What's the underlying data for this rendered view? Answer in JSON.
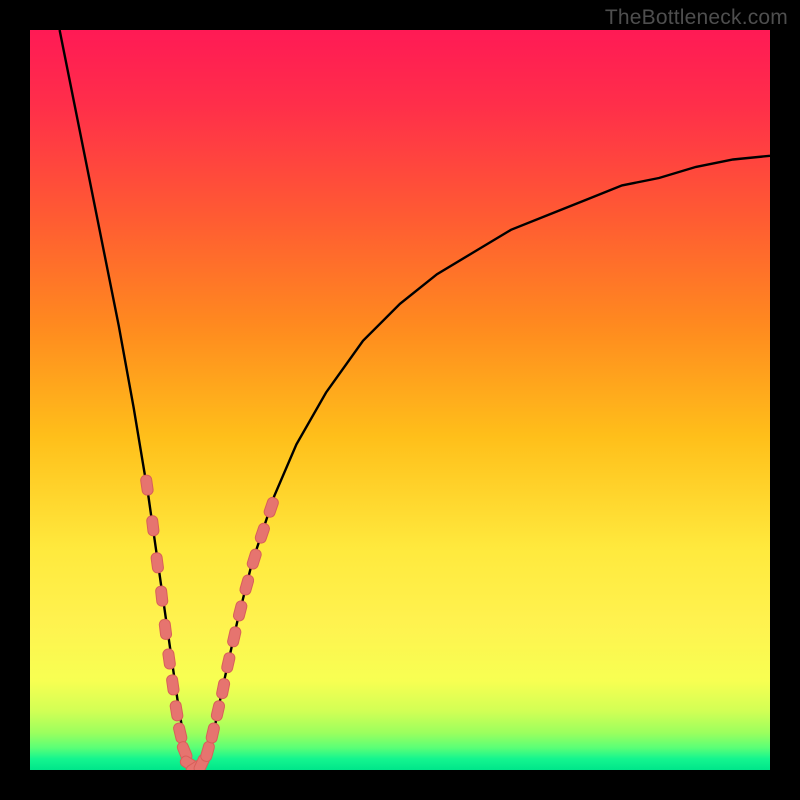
{
  "watermark": "TheBottleneck.com",
  "colors": {
    "frame": "#000000",
    "curve": "#000000",
    "marker_fill": "#e6746f",
    "marker_stroke": "#d85f5a",
    "gradient_stops": [
      {
        "offset": 0.0,
        "color": "#ff1a55"
      },
      {
        "offset": 0.1,
        "color": "#ff2e4a"
      },
      {
        "offset": 0.25,
        "color": "#ff5a33"
      },
      {
        "offset": 0.4,
        "color": "#ff8a1f"
      },
      {
        "offset": 0.55,
        "color": "#ffbf1a"
      },
      {
        "offset": 0.7,
        "color": "#ffe93d"
      },
      {
        "offset": 0.8,
        "color": "#fff24f"
      },
      {
        "offset": 0.88,
        "color": "#f7ff52"
      },
      {
        "offset": 0.92,
        "color": "#d2ff55"
      },
      {
        "offset": 0.95,
        "color": "#9bff5e"
      },
      {
        "offset": 0.97,
        "color": "#5aff77"
      },
      {
        "offset": 0.985,
        "color": "#14f58f"
      },
      {
        "offset": 1.0,
        "color": "#00e68a"
      }
    ]
  },
  "chart_data": {
    "type": "line",
    "title": "",
    "xlabel": "",
    "ylabel": "",
    "xlim": [
      0,
      100
    ],
    "ylim": [
      0,
      100
    ],
    "note": "Curve is a V-shaped dip reaching ~0 near x≈22; left branch is steep, right branch rises slowly toward ~83 at x=100. Values are estimated from the image.",
    "series": [
      {
        "name": "curve",
        "x": [
          4,
          6,
          8,
          10,
          12,
          14,
          16,
          18,
          19,
          20,
          21,
          22,
          23,
          24,
          25,
          26,
          28,
          30,
          33,
          36,
          40,
          45,
          50,
          55,
          60,
          65,
          70,
          75,
          80,
          85,
          90,
          95,
          100
        ],
        "y": [
          100,
          90,
          80,
          70,
          60,
          49,
          37,
          23,
          16,
          9,
          3,
          0,
          0,
          2,
          6,
          11,
          20,
          28,
          37,
          44,
          51,
          58,
          63,
          67,
          70,
          73,
          75,
          77,
          79,
          80,
          81.5,
          82.5,
          83
        ]
      }
    ],
    "markers": {
      "name": "highlighted-points",
      "shape": "rounded-rect",
      "points_xy": [
        [
          15.8,
          38.5
        ],
        [
          16.6,
          33.0
        ],
        [
          17.2,
          28.0
        ],
        [
          17.8,
          23.5
        ],
        [
          18.3,
          19.0
        ],
        [
          18.8,
          15.0
        ],
        [
          19.3,
          11.5
        ],
        [
          19.8,
          8.0
        ],
        [
          20.3,
          5.0
        ],
        [
          20.9,
          2.5
        ],
        [
          21.6,
          0.8
        ],
        [
          22.4,
          0.3
        ],
        [
          23.2,
          0.8
        ],
        [
          24.0,
          2.5
        ],
        [
          24.7,
          5.0
        ],
        [
          25.4,
          8.0
        ],
        [
          26.1,
          11.0
        ],
        [
          26.8,
          14.5
        ],
        [
          27.6,
          18.0
        ],
        [
          28.4,
          21.5
        ],
        [
          29.3,
          25.0
        ],
        [
          30.3,
          28.5
        ],
        [
          31.4,
          32.0
        ],
        [
          32.6,
          35.5
        ]
      ]
    }
  }
}
